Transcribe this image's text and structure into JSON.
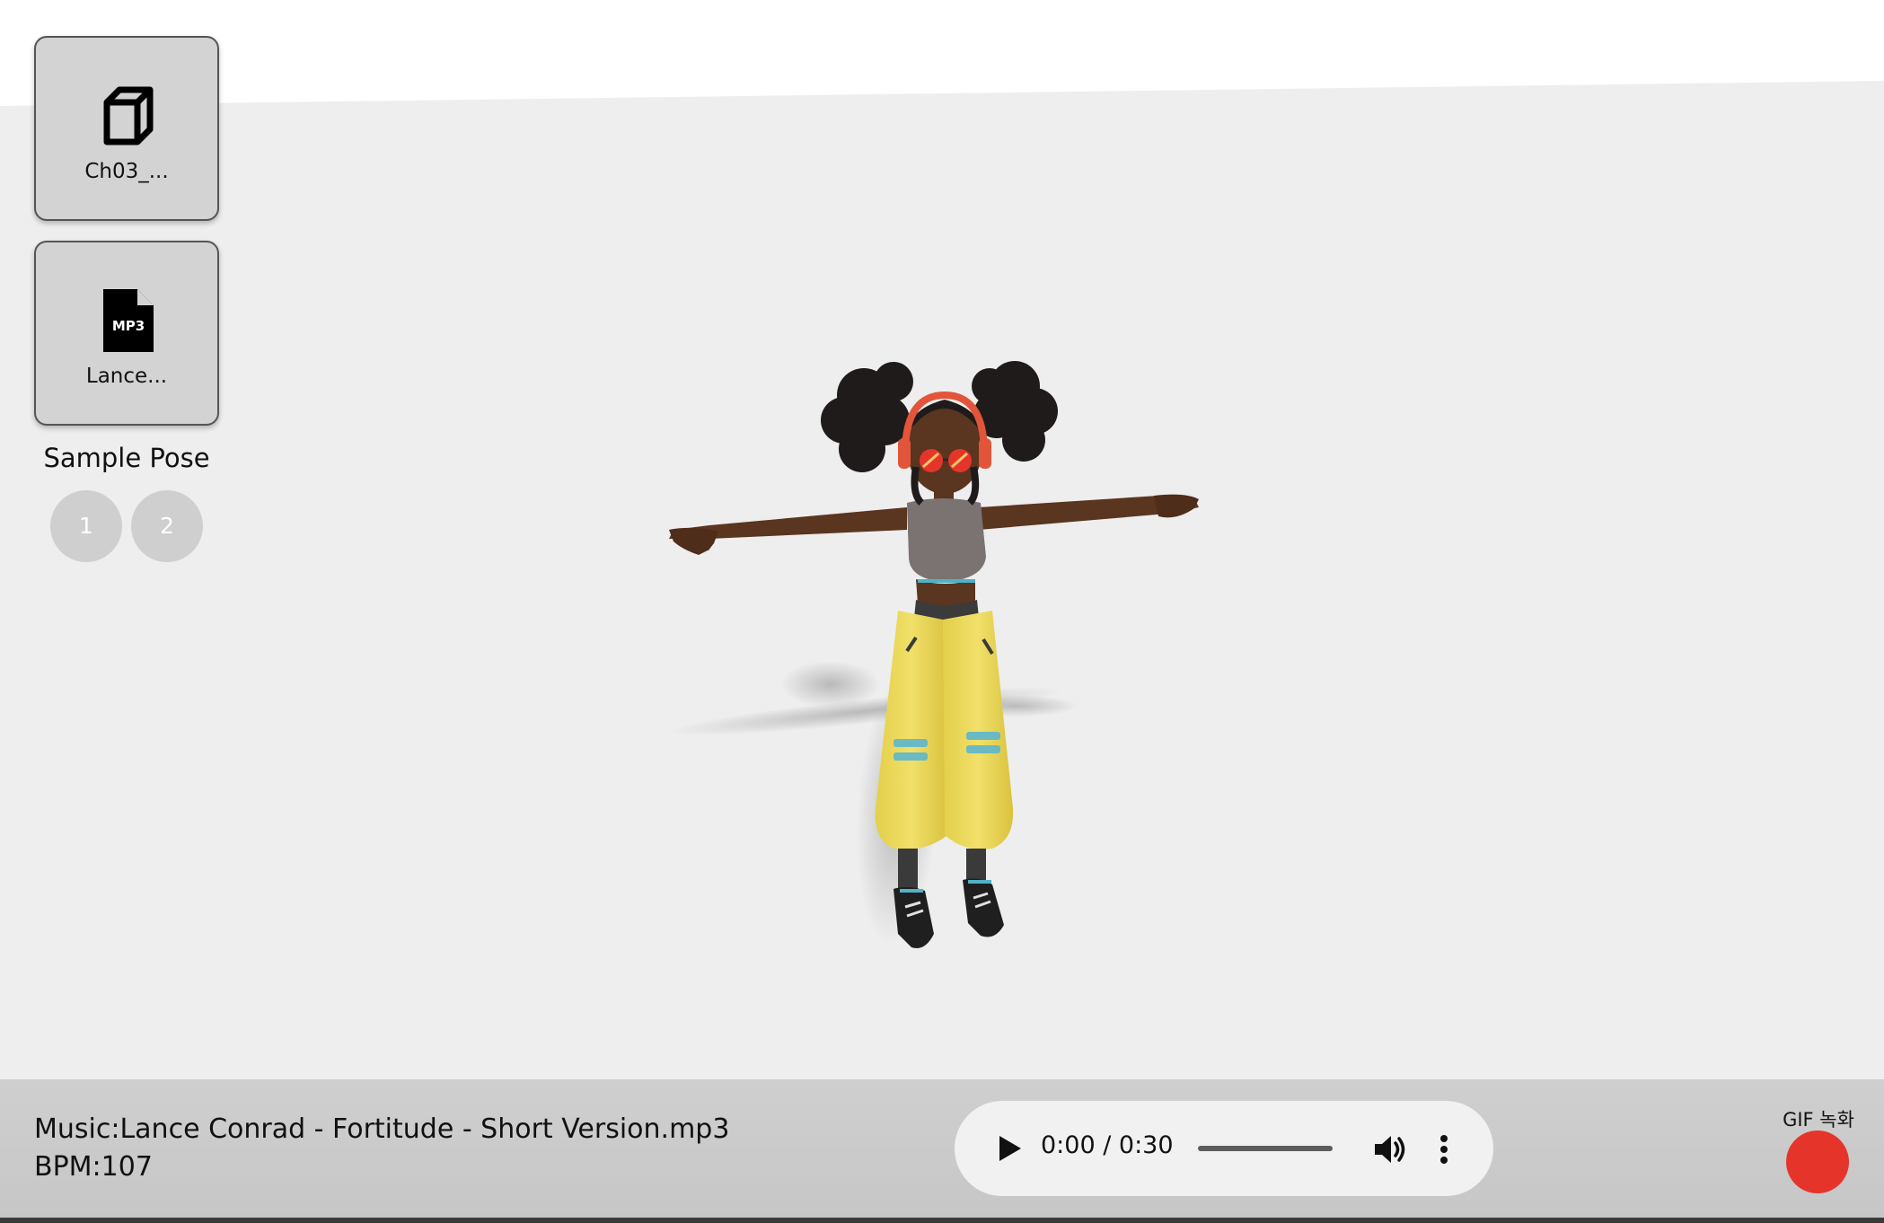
{
  "files": {
    "model": {
      "label": "Ch03_...",
      "icon": "cube-icon"
    },
    "music": {
      "label": "Lance...",
      "icon": "mp3-file-icon",
      "icon_text": "MP3"
    }
  },
  "sample_pose": {
    "title": "Sample Pose",
    "buttons": [
      "1",
      "2"
    ]
  },
  "music_info": {
    "music_line": "Music:Lance Conrad - Fortitude - Short Version.mp3",
    "bpm_line": "BPM:107"
  },
  "audio_player": {
    "time": "0:00 / 0:30",
    "progress": 0,
    "play_icon": "play-icon",
    "volume_icon": "volume-icon",
    "more_icon": "more-vertical-icon"
  },
  "gif_record": {
    "label": "GIF 녹화",
    "icon": "record-icon",
    "color": "#e5352b"
  },
  "colors": {
    "background": "#eeeeee",
    "bottom_bar": "#cbcbcb",
    "accent_top_border": "#3b6fd8",
    "pose_button": "#cfcfcf"
  }
}
